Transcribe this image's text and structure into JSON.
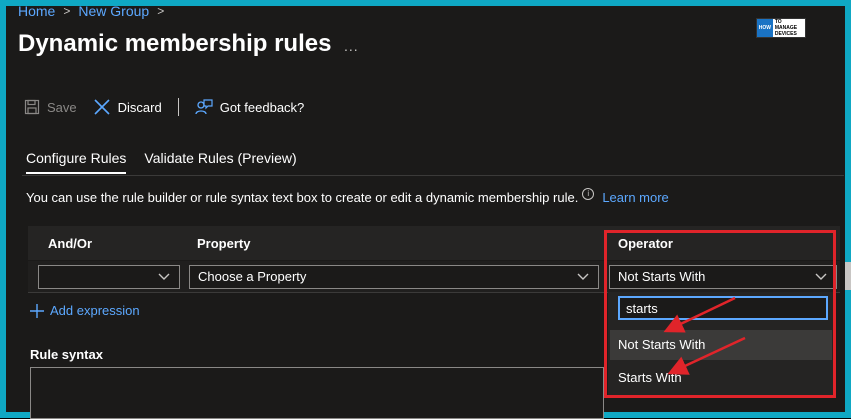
{
  "breadcrumb": {
    "items": [
      "Home",
      "New Group"
    ],
    "sep": ">"
  },
  "page": {
    "title": "Dynamic membership rules",
    "more": "..."
  },
  "logo": {
    "line1": "HOW",
    "line2": "TO MANAGE",
    "line3": "DEVICES"
  },
  "toolbar": {
    "save": "Save",
    "discard": "Discard",
    "feedback": "Got feedback?"
  },
  "tabs": {
    "configure": "Configure Rules",
    "validate": "Validate Rules (Preview)"
  },
  "description": {
    "text": "You can use the rule builder or rule syntax text box to create or edit a dynamic membership rule.",
    "info": "i",
    "link": "Learn more"
  },
  "grid": {
    "headers": {
      "andor": "And/Or",
      "property": "Property",
      "operator": "Operator"
    },
    "row": {
      "andor": "",
      "property": "Choose a Property",
      "operator": "Not Starts With"
    }
  },
  "add_expression": "Add expression",
  "rule_syntax_label": "Rule syntax",
  "dropdown": {
    "search_value": "starts",
    "options": [
      "Not Starts With",
      "Starts With"
    ]
  },
  "colors": {
    "accent": "#5ca8ff",
    "highlight": "#e0242a",
    "frame": "#0fa8c4"
  }
}
